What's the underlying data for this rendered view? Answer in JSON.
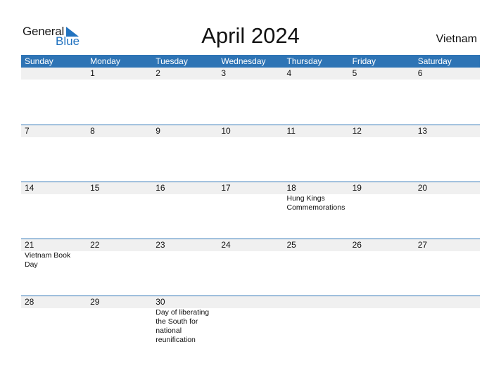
{
  "logo": {
    "line1": "General",
    "line2": "Blue",
    "brand_color": "#2273c0"
  },
  "header": {
    "title": "April 2024",
    "country": "Vietnam"
  },
  "colors": {
    "header_bg": "#2e74b5",
    "day_bg": "#f0f0f0"
  },
  "weekdays": [
    "Sunday",
    "Monday",
    "Tuesday",
    "Wednesday",
    "Thursday",
    "Friday",
    "Saturday"
  ],
  "weeks": [
    {
      "days": [
        "",
        "1",
        "2",
        "3",
        "4",
        "5",
        "6"
      ],
      "events": [
        "",
        "",
        "",
        "",
        "",
        "",
        ""
      ]
    },
    {
      "days": [
        "7",
        "8",
        "9",
        "10",
        "11",
        "12",
        "13"
      ],
      "events": [
        "",
        "",
        "",
        "",
        "",
        "",
        ""
      ]
    },
    {
      "days": [
        "14",
        "15",
        "16",
        "17",
        "18",
        "19",
        "20"
      ],
      "events": [
        "",
        "",
        "",
        "",
        "Hung Kings Commemorations",
        "",
        ""
      ]
    },
    {
      "days": [
        "21",
        "22",
        "23",
        "24",
        "25",
        "26",
        "27"
      ],
      "events": [
        "Vietnam Book Day",
        "",
        "",
        "",
        "",
        "",
        ""
      ]
    },
    {
      "days": [
        "28",
        "29",
        "30",
        "",
        "",
        "",
        ""
      ],
      "events": [
        "",
        "",
        "Day of liberating the South for national reunification",
        "",
        "",
        "",
        ""
      ]
    }
  ]
}
